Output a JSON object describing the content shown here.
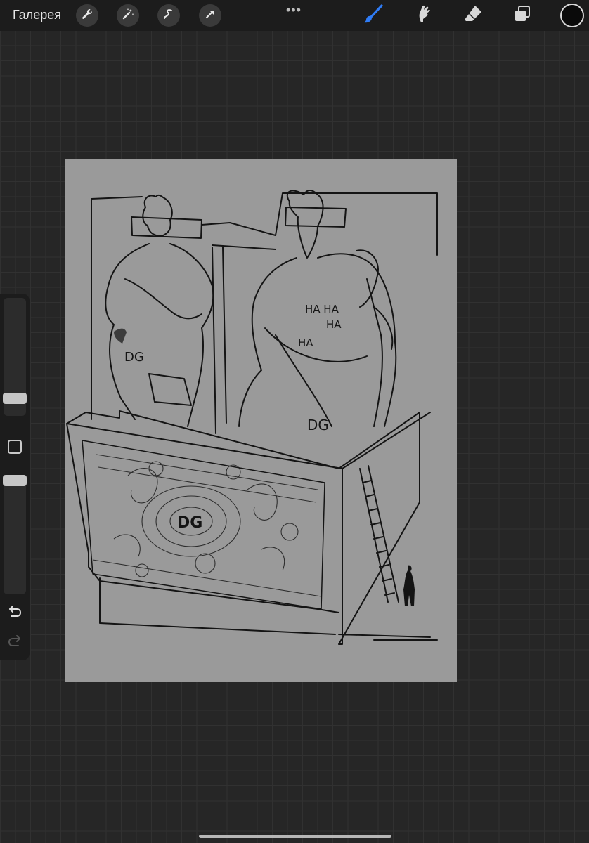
{
  "toolbar": {
    "gallery_label": "Галерея",
    "left_tools": [
      "wrench-icon",
      "magic-wand-icon",
      "selection-icon",
      "transform-arrow-icon"
    ],
    "more_menu": "•••",
    "right_tools": [
      "brush-icon",
      "smudge-icon",
      "eraser-icon",
      "layers-icon"
    ],
    "active_tool": "brush-icon",
    "accent_color": "#2f7cf6",
    "current_color": "#0a0a0a"
  },
  "sidebar": {
    "brush_size_level": 0.25,
    "opacity_level": 1.0
  },
  "artwork": {
    "scribbles": [
      "HA HA",
      "HA",
      "HA",
      "DG",
      "DG",
      "DG"
    ],
    "background_color": "#9a9a9a"
  }
}
